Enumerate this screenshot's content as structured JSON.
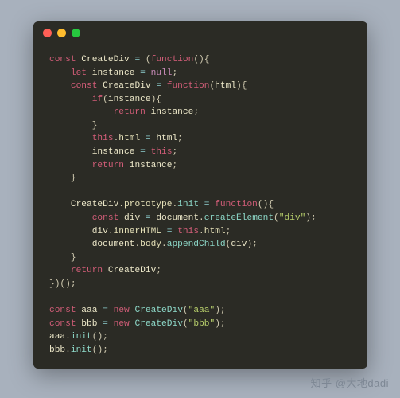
{
  "code": {
    "lines": [
      [
        [
          "",
          ""
        ],
        [
          "kw",
          "const"
        ],
        [
          "pn",
          " "
        ],
        [
          "id",
          "CreateDiv"
        ],
        [
          "pn",
          " "
        ],
        [
          "eq",
          "="
        ],
        [
          "pn",
          " ("
        ],
        [
          "kw",
          "function"
        ],
        [
          "pn",
          "(){"
        ]
      ],
      [
        [
          "",
          "    "
        ],
        [
          "kw",
          "let"
        ],
        [
          "pn",
          " "
        ],
        [
          "id",
          "instance"
        ],
        [
          "pn",
          " "
        ],
        [
          "eq",
          "="
        ],
        [
          "pn",
          " "
        ],
        [
          "nul",
          "null"
        ],
        [
          "pn",
          ";"
        ]
      ],
      [
        [
          "",
          "    "
        ],
        [
          "kw",
          "const"
        ],
        [
          "pn",
          " "
        ],
        [
          "id",
          "CreateDiv"
        ],
        [
          "pn",
          " "
        ],
        [
          "eq",
          "="
        ],
        [
          "pn",
          " "
        ],
        [
          "kw",
          "function"
        ],
        [
          "pn",
          "("
        ],
        [
          "id",
          "html"
        ],
        [
          "pn",
          "){"
        ]
      ],
      [
        [
          "",
          "        "
        ],
        [
          "kw",
          "if"
        ],
        [
          "pn",
          "("
        ],
        [
          "id",
          "instance"
        ],
        [
          "pn",
          "){"
        ]
      ],
      [
        [
          "",
          "            "
        ],
        [
          "kw",
          "return"
        ],
        [
          "pn",
          " "
        ],
        [
          "id",
          "instance"
        ],
        [
          "pn",
          ";"
        ]
      ],
      [
        [
          "",
          "        "
        ],
        [
          "pn",
          "}"
        ]
      ],
      [
        [
          "",
          "        "
        ],
        [
          "kw",
          "this"
        ],
        [
          "pn",
          "."
        ],
        [
          "prop",
          "html"
        ],
        [
          "pn",
          " "
        ],
        [
          "eq",
          "="
        ],
        [
          "pn",
          " "
        ],
        [
          "id",
          "html"
        ],
        [
          "pn",
          ";"
        ]
      ],
      [
        [
          "",
          "        "
        ],
        [
          "id",
          "instance"
        ],
        [
          "pn",
          " "
        ],
        [
          "eq",
          "="
        ],
        [
          "pn",
          " "
        ],
        [
          "kw",
          "this"
        ],
        [
          "pn",
          ";"
        ]
      ],
      [
        [
          "",
          "        "
        ],
        [
          "kw",
          "return"
        ],
        [
          "pn",
          " "
        ],
        [
          "id",
          "instance"
        ],
        [
          "pn",
          ";"
        ]
      ],
      [
        [
          "",
          "    "
        ],
        [
          "pn",
          "}"
        ]
      ],
      [
        [
          "",
          ""
        ]
      ],
      [
        [
          "",
          "    "
        ],
        [
          "id",
          "CreateDiv"
        ],
        [
          "pn",
          "."
        ],
        [
          "prop",
          "prototype"
        ],
        [
          "pn",
          "."
        ],
        [
          "fn",
          "init"
        ],
        [
          "pn",
          " "
        ],
        [
          "eq",
          "="
        ],
        [
          "pn",
          " "
        ],
        [
          "kw",
          "function"
        ],
        [
          "pn",
          "(){"
        ]
      ],
      [
        [
          "",
          "        "
        ],
        [
          "kw",
          "const"
        ],
        [
          "pn",
          " "
        ],
        [
          "id",
          "div"
        ],
        [
          "pn",
          " "
        ],
        [
          "eq",
          "="
        ],
        [
          "pn",
          " "
        ],
        [
          "id",
          "document"
        ],
        [
          "pn",
          "."
        ],
        [
          "fn",
          "createElement"
        ],
        [
          "pn",
          "("
        ],
        [
          "str",
          "\"div\""
        ],
        [
          "pn",
          ");"
        ]
      ],
      [
        [
          "",
          "        "
        ],
        [
          "id",
          "div"
        ],
        [
          "pn",
          "."
        ],
        [
          "prop",
          "innerHTML"
        ],
        [
          "pn",
          " "
        ],
        [
          "eq",
          "="
        ],
        [
          "pn",
          " "
        ],
        [
          "kw",
          "this"
        ],
        [
          "pn",
          "."
        ],
        [
          "prop",
          "html"
        ],
        [
          "pn",
          ";"
        ]
      ],
      [
        [
          "",
          "        "
        ],
        [
          "id",
          "document"
        ],
        [
          "pn",
          "."
        ],
        [
          "prop",
          "body"
        ],
        [
          "pn",
          "."
        ],
        [
          "fn",
          "appendChild"
        ],
        [
          "pn",
          "("
        ],
        [
          "id",
          "div"
        ],
        [
          "pn",
          ");"
        ]
      ],
      [
        [
          "",
          "    "
        ],
        [
          "pn",
          "}"
        ]
      ],
      [
        [
          "",
          "    "
        ],
        [
          "kw",
          "return"
        ],
        [
          "pn",
          " "
        ],
        [
          "id",
          "CreateDiv"
        ],
        [
          "pn",
          ";"
        ]
      ],
      [
        [
          "",
          ""
        ],
        [
          "pn",
          "})();"
        ]
      ],
      [
        [
          "",
          ""
        ]
      ],
      [
        [
          "",
          ""
        ],
        [
          "kw",
          "const"
        ],
        [
          "pn",
          " "
        ],
        [
          "id",
          "aaa"
        ],
        [
          "pn",
          " "
        ],
        [
          "eq",
          "="
        ],
        [
          "pn",
          " "
        ],
        [
          "kw",
          "new"
        ],
        [
          "pn",
          " "
        ],
        [
          "fn",
          "CreateDiv"
        ],
        [
          "pn",
          "("
        ],
        [
          "str",
          "\"aaa\""
        ],
        [
          "pn",
          ");"
        ]
      ],
      [
        [
          "",
          ""
        ],
        [
          "kw",
          "const"
        ],
        [
          "pn",
          " "
        ],
        [
          "id",
          "bbb"
        ],
        [
          "pn",
          " "
        ],
        [
          "eq",
          "="
        ],
        [
          "pn",
          " "
        ],
        [
          "kw",
          "new"
        ],
        [
          "pn",
          " "
        ],
        [
          "fn",
          "CreateDiv"
        ],
        [
          "pn",
          "("
        ],
        [
          "str",
          "\"bbb\""
        ],
        [
          "pn",
          ");"
        ]
      ],
      [
        [
          "",
          ""
        ],
        [
          "id",
          "aaa"
        ],
        [
          "pn",
          "."
        ],
        [
          "fn",
          "init"
        ],
        [
          "pn",
          "();"
        ]
      ],
      [
        [
          "",
          ""
        ],
        [
          "id",
          "bbb"
        ],
        [
          "pn",
          "."
        ],
        [
          "fn",
          "init"
        ],
        [
          "pn",
          "();"
        ]
      ]
    ]
  },
  "watermark": "知乎 @大地dadi"
}
